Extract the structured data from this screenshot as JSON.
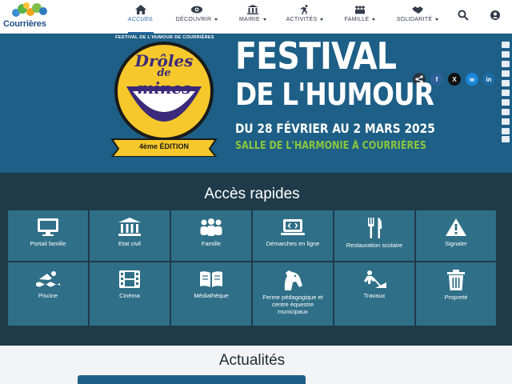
{
  "header": {
    "logo_text": "Courrières",
    "nav": [
      {
        "label": "ACCUEIL",
        "icon": "home-icon"
      },
      {
        "label": "DÉCOUVRIR",
        "icon": "eye-icon"
      },
      {
        "label": "MAIRIE",
        "icon": "institution-icon"
      },
      {
        "label": "ACTIVITÉS",
        "icon": "running-icon"
      },
      {
        "label": "FAMILLE",
        "icon": "users-icon"
      },
      {
        "label": "SOLIDARITÉ",
        "icon": "handshake-icon"
      }
    ],
    "search_icon": "search-icon",
    "account_icon": "user-circle-icon"
  },
  "banner": {
    "badge_arc": "FESTIVAL DE L'HUMOUR DE COURRIÈRES",
    "badge_line1": "Drôles",
    "badge_line2": "de",
    "badge_line3": "mines",
    "badge_edition": "4ème ÉDITION",
    "title_line1": "FESTIVAL",
    "title_line2": "DE L'HUMOUR",
    "dates": "DU 28 FÉVRIER AU 2 MARS 2025",
    "venue": "SALLE DE L'HARMONIE À COURRIÈRES",
    "share": [
      {
        "icon": "share-icon",
        "color": "#2b3440"
      },
      {
        "icon": "facebook-icon",
        "text": "f",
        "color": "#2d5f9a"
      },
      {
        "icon": "x-icon",
        "text": "X",
        "color": "#111111"
      },
      {
        "icon": "bluesky-icon",
        "text": "w",
        "color": "#1b86d8"
      },
      {
        "icon": "linkedin-icon",
        "text": "in",
        "color": "#1c6ba3"
      }
    ]
  },
  "quick_access": {
    "title": "Accès rapides",
    "tiles": [
      {
        "label": "Portail famille",
        "icon": "monitor-icon"
      },
      {
        "label": "Etat civil",
        "icon": "institution-icon"
      },
      {
        "label": "Famille",
        "icon": "users-icon"
      },
      {
        "label": "Démarches en ligne",
        "icon": "laptop-code-icon"
      },
      {
        "label": "Restauration scolaire",
        "icon": "utensils-icon"
      },
      {
        "label": "Signaler",
        "icon": "warning-icon"
      },
      {
        "label": "Piscine",
        "icon": "swimmer-icon"
      },
      {
        "label": "Cinéma",
        "icon": "film-icon"
      },
      {
        "label": "Médiathèque",
        "icon": "book-open-icon"
      },
      {
        "label": "Ferme pédagogique et centre équestre municipaux",
        "icon": "horse-icon"
      },
      {
        "label": "Travaux",
        "icon": "digging-icon"
      },
      {
        "label": "Propreté",
        "icon": "trash-icon"
      }
    ]
  },
  "news": {
    "title": "Actualités"
  }
}
